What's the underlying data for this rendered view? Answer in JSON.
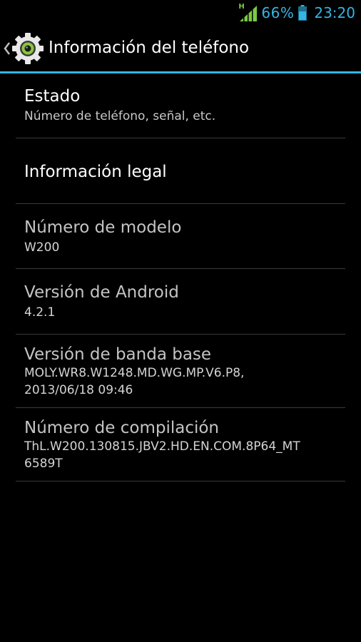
{
  "status_bar": {
    "network_type": "H",
    "battery_percent": "66%",
    "time": "23:20"
  },
  "action_bar": {
    "title": "Información del teléfono"
  },
  "items": [
    {
      "title": "Estado",
      "summary": "Número de teléfono, señal, etc."
    },
    {
      "title": "Información legal",
      "summary": ""
    },
    {
      "title": "Número de modelo",
      "summary": "W200"
    },
    {
      "title": "Versión de Android",
      "summary": "4.2.1"
    },
    {
      "title": "Versión de banda base",
      "summary_lines": [
        "MOLY.WR8.W1248.MD.WG.MP.V6.P8,",
        "2013/06/18 09:46"
      ]
    },
    {
      "title": "Número de compilación",
      "summary_lines": [
        "ThL.W200.130815.JBV2.HD.EN.COM.8P64_MT",
        "6589T"
      ]
    }
  ],
  "colors": {
    "accent": "#33b5e5",
    "signal_green": "#7ac943",
    "background": "#000000"
  },
  "icons": {
    "signal": "signal-strength-icon",
    "battery": "battery-icon",
    "up": "chevron-left-icon",
    "app": "settings-gear-icon"
  }
}
